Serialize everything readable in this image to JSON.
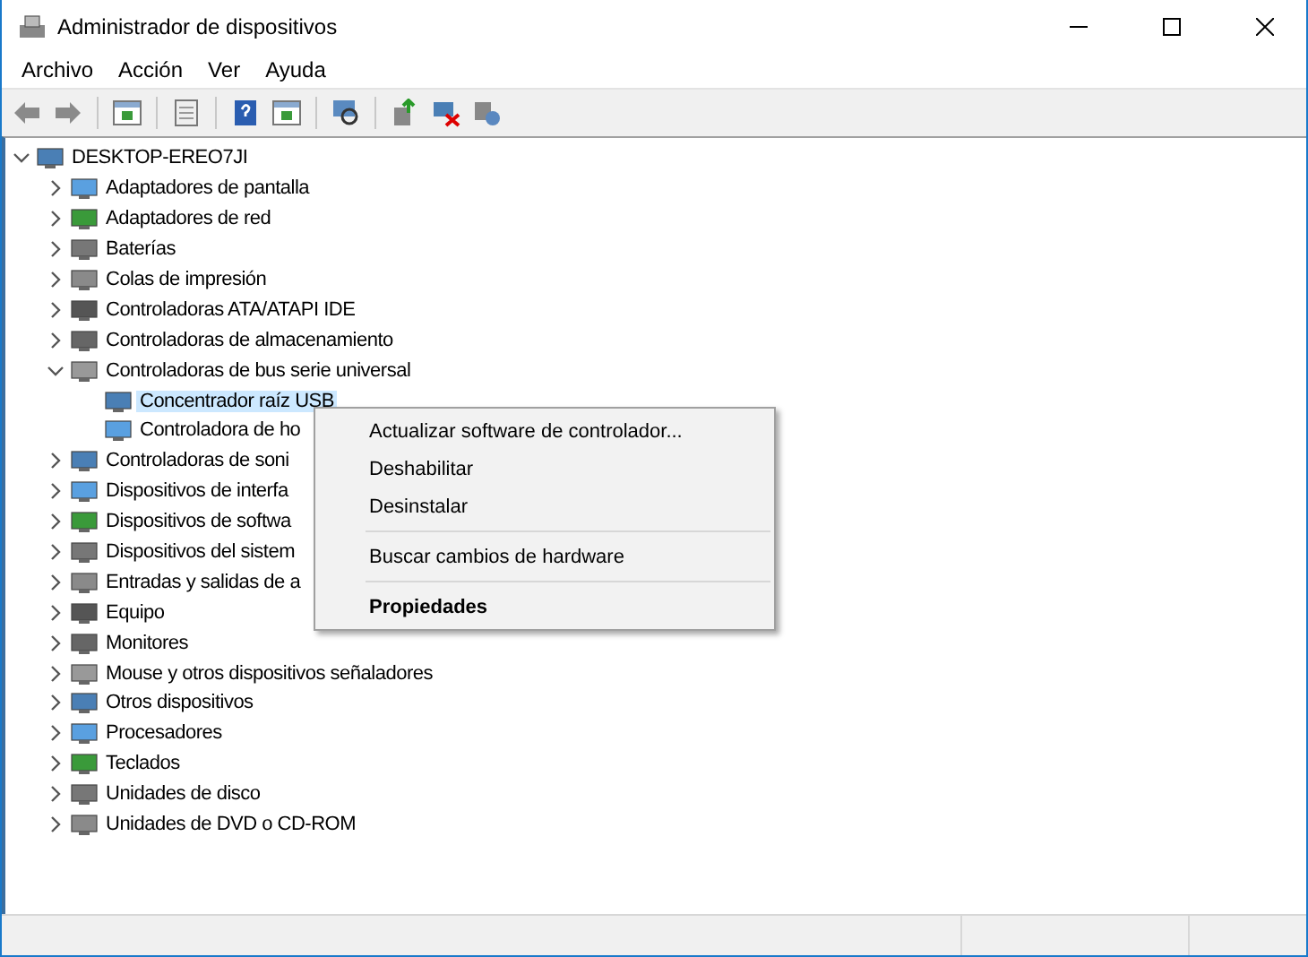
{
  "window": {
    "title": "Administrador de dispositivos"
  },
  "menu": [
    "Archivo",
    "Acción",
    "Ver",
    "Ayuda"
  ],
  "tree": [
    {
      "label": "DESKTOP-EREO7JI",
      "expanded": true,
      "selected": false,
      "children": [
        {
          "label": "Adaptadores de pantalla",
          "expanded": false,
          "selected": false
        },
        {
          "label": "Adaptadores de red",
          "expanded": false,
          "selected": false
        },
        {
          "label": "Baterías",
          "expanded": false,
          "selected": false
        },
        {
          "label": "Colas de impresión",
          "expanded": false,
          "selected": false
        },
        {
          "label": "Controladoras ATA/ATAPI IDE",
          "expanded": false,
          "selected": false
        },
        {
          "label": "Controladoras de almacenamiento",
          "expanded": false,
          "selected": false
        },
        {
          "label": "Controladoras de bus serie universal",
          "expanded": true,
          "selected": false,
          "children": [
            {
              "label": "Concentrador raíz USB",
              "selected": true
            },
            {
              "label": "Controladora de ho",
              "selected": false
            }
          ]
        },
        {
          "label": "Controladoras de soni",
          "expanded": false,
          "selected": false
        },
        {
          "label": "Dispositivos de interfa",
          "expanded": false,
          "selected": false
        },
        {
          "label": "Dispositivos de softwa",
          "expanded": false,
          "selected": false
        },
        {
          "label": "Dispositivos del sistem",
          "expanded": false,
          "selected": false
        },
        {
          "label": "Entradas y salidas de a",
          "expanded": false,
          "selected": false
        },
        {
          "label": "Equipo",
          "expanded": false,
          "selected": false
        },
        {
          "label": "Monitores",
          "expanded": false,
          "selected": false
        },
        {
          "label": "Mouse y otros dispositivos señaladores",
          "expanded": false,
          "selected": false
        },
        {
          "label": "Otros dispositivos",
          "expanded": false,
          "selected": false
        },
        {
          "label": "Procesadores",
          "expanded": false,
          "selected": false
        },
        {
          "label": "Teclados",
          "expanded": false,
          "selected": false
        },
        {
          "label": "Unidades de disco",
          "expanded": false,
          "selected": false
        },
        {
          "label": "Unidades de DVD o CD-ROM",
          "expanded": false,
          "selected": false
        }
      ]
    }
  ],
  "context_menu": [
    {
      "kind": "item",
      "label": "Actualizar software de controlador...",
      "default": false
    },
    {
      "kind": "item",
      "label": "Deshabilitar",
      "default": false
    },
    {
      "kind": "item",
      "label": "Desinstalar",
      "default": false
    },
    {
      "kind": "separator"
    },
    {
      "kind": "item",
      "label": "Buscar cambios de hardware",
      "default": false
    },
    {
      "kind": "separator"
    },
    {
      "kind": "item",
      "label": "Propiedades",
      "default": true
    }
  ]
}
